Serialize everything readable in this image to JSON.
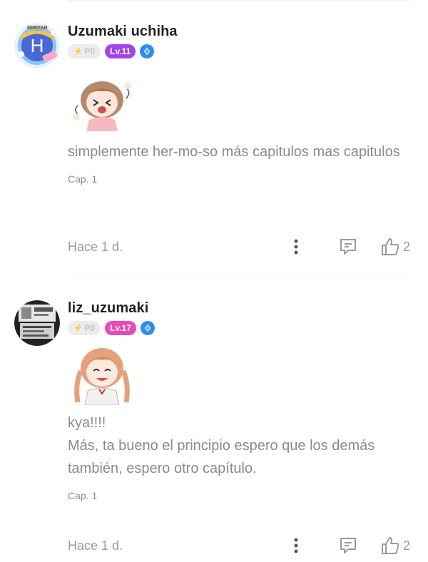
{
  "comments": [
    {
      "avatar_letter": "H",
      "avatar_banner": "MIRITAR",
      "username": "Uzumaki uchiha",
      "points": "P0",
      "level": "Lv.11",
      "level_color": "#a244e6",
      "text": "simplemente her-mo-so más capitulos mas capitulos",
      "chapter": "Cap. 1",
      "time": "Hace 1 d.",
      "likes": "2",
      "sticker": "cheering-girl-sticker"
    },
    {
      "username": "liz_uzumaki",
      "points": "P0",
      "level": "Lv.17",
      "level_color": "#e84bb3",
      "text": "kya!!!!\nMás, ta bueno el principio espero que los demás también, espero otro capítulo.",
      "chapter": "Cap. 1",
      "time": "Hace 1 d.",
      "likes": "2",
      "sticker": "smiling-girl-sticker"
    }
  ],
  "colors": {
    "verified": "#2f8df0",
    "muted_text": "#8a8a8a"
  }
}
